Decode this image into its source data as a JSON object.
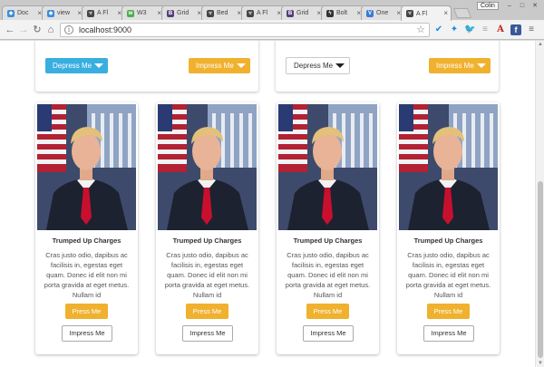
{
  "browser": {
    "tabs": [
      {
        "label": "Doc",
        "icon": "diamond-icon",
        "color": "#3b8fd9"
      },
      {
        "label": "view",
        "icon": "diamond-icon",
        "color": "#3b8fd9"
      },
      {
        "label": "A Fl",
        "icon": "biohazard-icon",
        "color": "#444444"
      },
      {
        "label": "W3",
        "icon": "w3-icon",
        "color": "#4caf50"
      },
      {
        "label": "Grid",
        "icon": "bootstrap-icon",
        "color": "#563d7c"
      },
      {
        "label": "Bed",
        "icon": "biohazard-icon",
        "color": "#444444"
      },
      {
        "label": "A Fl",
        "icon": "biohazard-icon",
        "color": "#444444"
      },
      {
        "label": "Grid",
        "icon": "bootstrap-icon",
        "color": "#563d7c"
      },
      {
        "label": "Bolt",
        "icon": "bolt-icon",
        "color": "#333333"
      },
      {
        "label": "One",
        "icon": "v-icon",
        "color": "#3a7bd5"
      },
      {
        "label": "A Fl",
        "icon": "biohazard-icon",
        "color": "#444444",
        "active": true
      }
    ],
    "profile": "Colin",
    "url": "localhost:9000",
    "nav": {
      "back": "←",
      "forward": "→",
      "reload": "↻",
      "home": "⌂"
    }
  },
  "top_buttons": {
    "panel1": {
      "left_label": "Depress Me",
      "right_label": "Impress Me"
    },
    "panel2": {
      "left_label": "Depress Me",
      "right_label": "Impress Me"
    }
  },
  "cards": [
    {
      "title": "Trumped Up Charges",
      "text": "Cras justo odio, dapibus ac facilisis in, egestas eget quam. Donec id elit non mi porta gravida at eget metus. Nullam id",
      "press_label": "Press Me",
      "impress_label": "Impress Me"
    },
    {
      "title": "Trumped Up Charges",
      "text": "Cras justo odio, dapibus ac facilisis in, egestas eget quam. Donec id elit non mi porta gravida at eget metus. Nullam id",
      "press_label": "Press Me",
      "impress_label": "Impress Me"
    },
    {
      "title": "Trumped Up Charges",
      "text": "Cras justo odio, dapibus ac facilisis in, egestas eget quam. Donec id elit non mi porta gravida at eget metus. Nullam id",
      "press_label": "Press Me",
      "impress_label": "Impress Me"
    },
    {
      "title": "Trumped Up Charges",
      "text": "Cras justo odio, dapibus ac facilisis in, egestas eget quam. Donec id elit non mi porta gravida at eget metus. Nullam id",
      "press_label": "Press Me",
      "impress_label": "Impress Me"
    }
  ],
  "colors": {
    "info": "#39aee0",
    "warning": "#f0b12e"
  }
}
